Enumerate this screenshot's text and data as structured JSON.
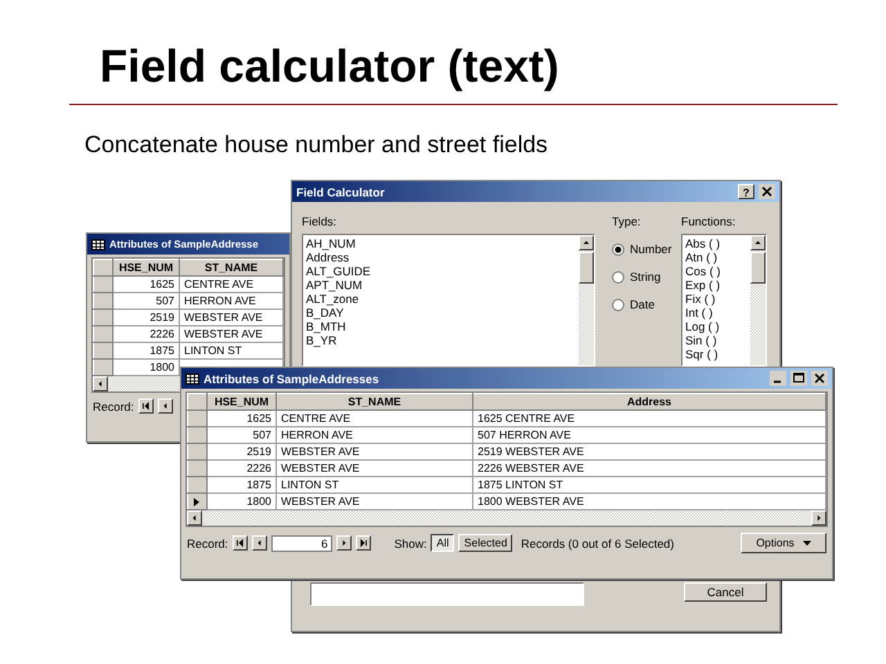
{
  "slide": {
    "title": "Field calculator (text)",
    "subtitle": "Concatenate house number and street fields"
  },
  "back_table": {
    "title": "Attributes of SampleAddresse",
    "columns": [
      "HSE_NUM",
      "ST_NAME"
    ],
    "rows": [
      [
        "1625",
        "CENTRE AVE"
      ],
      [
        "507",
        "HERRON AVE"
      ],
      [
        "2519",
        "WEBSTER AVE"
      ],
      [
        "2226",
        "WEBSTER AVE"
      ],
      [
        "1875",
        "LINTON ST"
      ],
      [
        "1800",
        ""
      ]
    ],
    "record_label": "Record:"
  },
  "field_calculator": {
    "title": "Field Calculator",
    "help": "?",
    "fields_label": "Fields:",
    "fields": [
      "AH_NUM",
      "Address",
      "ALT_GUIDE",
      "APT_NUM",
      "ALT_zone",
      "B_DAY",
      "B_MTH",
      "B_YR"
    ],
    "type_label": "Type:",
    "types": [
      {
        "label": "Number",
        "selected": true
      },
      {
        "label": "String",
        "selected": false
      },
      {
        "label": "Date",
        "selected": false
      }
    ],
    "functions_label": "Functions:",
    "functions": [
      "Abs ( )",
      "Atn ( )",
      "Cos ( )",
      "Exp ( )",
      "Fix ( )",
      "Int ( )",
      "Log ( )",
      "Sin ( )",
      "Sqr ( )"
    ],
    "cancel": "Cancel"
  },
  "front_table": {
    "title": "Attributes of SampleAddresses",
    "columns": [
      "HSE_NUM",
      "ST_NAME",
      "Address"
    ],
    "rows": [
      {
        "cells": [
          "1625",
          "CENTRE AVE",
          "1625 CENTRE AVE"
        ],
        "current": false
      },
      {
        "cells": [
          "507",
          "HERRON AVE",
          "507 HERRON AVE"
        ],
        "current": false
      },
      {
        "cells": [
          "2519",
          "WEBSTER AVE",
          "2519 WEBSTER AVE"
        ],
        "current": false
      },
      {
        "cells": [
          "2226",
          "WEBSTER AVE",
          "2226 WEBSTER AVE"
        ],
        "current": false
      },
      {
        "cells": [
          "1875",
          "LINTON ST",
          "1875 LINTON ST"
        ],
        "current": false
      },
      {
        "cells": [
          "1800",
          "WEBSTER AVE",
          "1800 WEBSTER AVE"
        ],
        "current": true
      }
    ],
    "record_label": "Record:",
    "record_value": "6",
    "show_label": "Show:",
    "show_options": [
      {
        "label": "All",
        "selected": true
      },
      {
        "label": "Selected",
        "selected": false
      }
    ],
    "status": "Records (0 out of 6 Selected)",
    "options": "Options"
  }
}
